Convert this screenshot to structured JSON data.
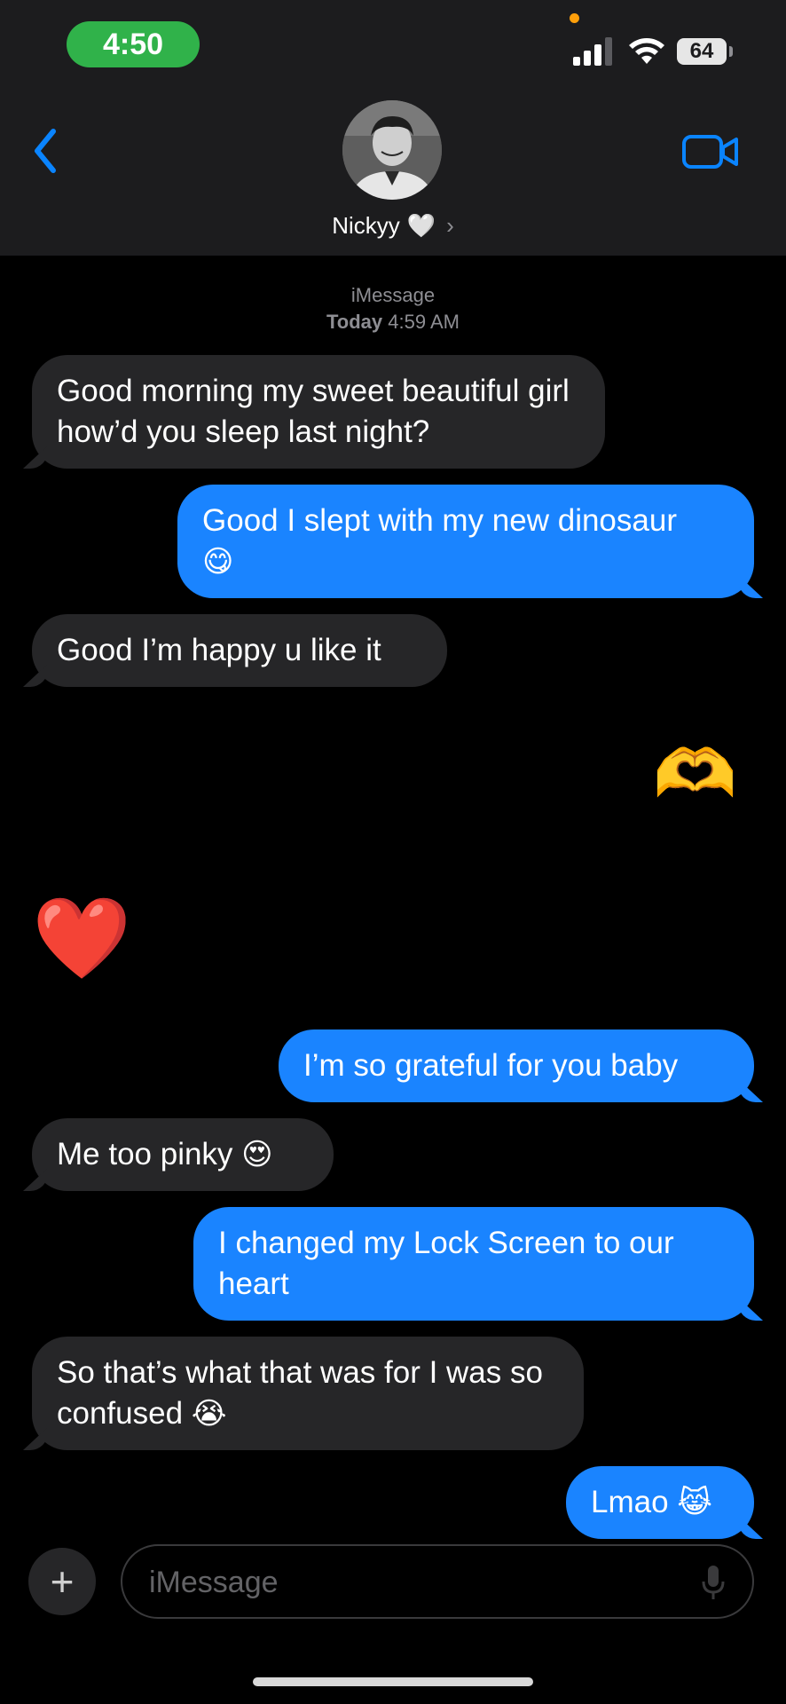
{
  "status_bar": {
    "time": "4:50",
    "battery": "64",
    "icons": [
      "signal-icon",
      "wifi-icon",
      "battery-icon"
    ]
  },
  "header": {
    "contact_name": "Nickyy",
    "name_emoji": "🤍",
    "chevron": "›",
    "icons": [
      "back-chevron-icon",
      "video-camera-icon",
      "avatar"
    ]
  },
  "conversation": {
    "service": "iMessage",
    "day": "Today",
    "time": "4:59 AM"
  },
  "messages": [
    {
      "from": "them",
      "text": "Good morning my sweet beautiful girl how’d you sleep last night?"
    },
    {
      "from": "me",
      "text": "Good I slept with my new dinosaur",
      "emoji": "😋"
    },
    {
      "from": "them",
      "text": "Good I’m happy u like it"
    },
    {
      "from": "me",
      "emoji_only": "🫶"
    },
    {
      "from": "them",
      "emoji_only": "❤️"
    },
    {
      "from": "me",
      "text": "I’m so grateful for you baby"
    },
    {
      "from": "them",
      "text": "Me too pinky",
      "emoji": "😍"
    },
    {
      "from": "me",
      "text": "I changed my Lock Screen to our heart"
    },
    {
      "from": "them",
      "text": "So that’s what that was for I was so confused",
      "emoji": "😭"
    },
    {
      "from": "me",
      "text": "Lmao",
      "emoji": "😹"
    }
  ],
  "composer": {
    "plus": "+",
    "placeholder": "iMessage"
  },
  "colors": {
    "outgoing_bubble": "#1a84ff",
    "incoming_bubble": "#262628",
    "header_bg": "#1c1c1e",
    "time_pill": "#30b24a",
    "accent": "#0a84ff"
  }
}
